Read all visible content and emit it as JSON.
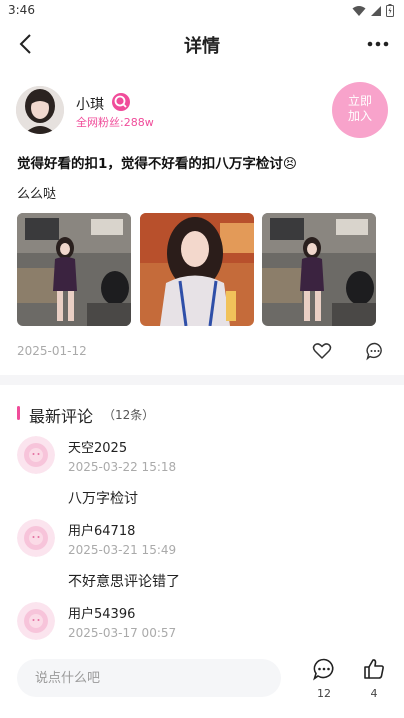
{
  "status_bar": {
    "time": "3:46"
  },
  "header": {
    "title": "详情"
  },
  "author": {
    "name": "小琪",
    "fans": "全网粉丝:288w",
    "join_label": "立即\n加入"
  },
  "post": {
    "title": "觉得好看的扣1，觉得不好看的扣八万字检讨😣",
    "body": "么么哒",
    "date": "2025-01-12"
  },
  "comments_section": {
    "label": "最新评论",
    "count": "（12条）"
  },
  "comments": [
    {
      "name": "天空2025",
      "time": "2025-03-22 15:18",
      "text": "八万字检讨"
    },
    {
      "name": "用户64718",
      "time": "2025-03-21 15:49",
      "text": "不好意思评论错了"
    },
    {
      "name": "用户54396",
      "time": "2025-03-17 00:57",
      "text": ""
    }
  ],
  "input": {
    "placeholder": "说点什么吧"
  },
  "stats": {
    "comments": "12",
    "likes": "4"
  },
  "colors": {
    "accent": "#f04c9a",
    "join_button": "#f8a3cb",
    "muted_text": "#aaaaaa",
    "divider": "#f5f5f7"
  }
}
